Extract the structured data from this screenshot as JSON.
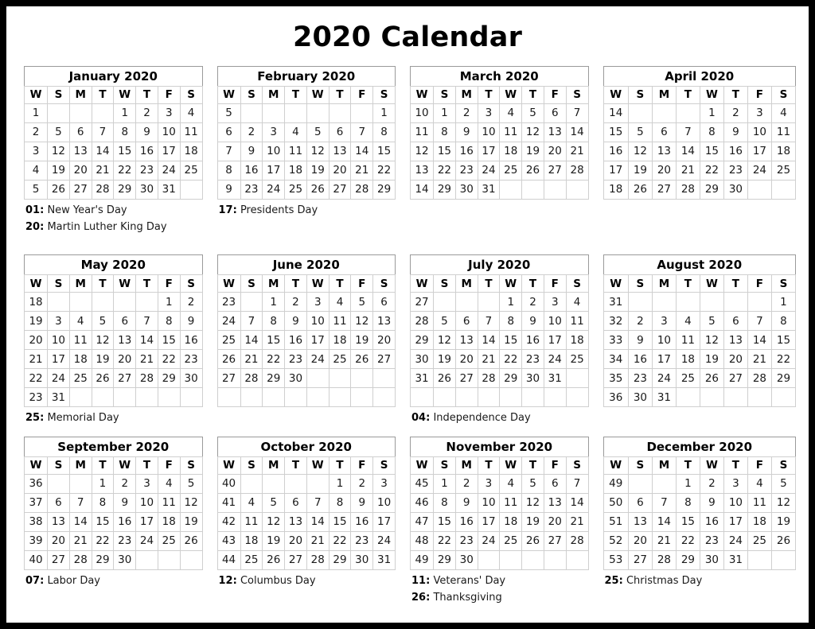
{
  "title": "2020 Calendar",
  "colors": {
    "week_number": "#3a9a3a",
    "holiday": "#e8202a",
    "text": "#1a1a1a",
    "border": "#cfcfcf",
    "page_border": "#000000"
  },
  "weekday_headers": [
    "W",
    "S",
    "M",
    "T",
    "W",
    "T",
    "F",
    "S"
  ],
  "months": [
    {
      "name": "January 2020",
      "weeks": [
        {
          "week": "1",
          "days": [
            "",
            "",
            "",
            "1",
            "2",
            "3",
            "4"
          ],
          "holidays": [
            1
          ]
        },
        {
          "week": "2",
          "days": [
            "5",
            "6",
            "7",
            "8",
            "9",
            "10",
            "11"
          ],
          "holidays": []
        },
        {
          "week": "3",
          "days": [
            "12",
            "13",
            "14",
            "15",
            "16",
            "17",
            "18"
          ],
          "holidays": []
        },
        {
          "week": "4",
          "days": [
            "19",
            "20",
            "21",
            "22",
            "23",
            "24",
            "25"
          ],
          "holidays": [
            20
          ]
        },
        {
          "week": "5",
          "days": [
            "26",
            "27",
            "28",
            "29",
            "30",
            "31",
            ""
          ],
          "holidays": []
        }
      ],
      "notes": [
        {
          "day": "01:",
          "label": "New Year's Day"
        },
        {
          "day": "20:",
          "label": "Martin Luther King Day"
        }
      ]
    },
    {
      "name": "February 2020",
      "weeks": [
        {
          "week": "5",
          "days": [
            "",
            "",
            "",
            "",
            "",
            "",
            "1"
          ],
          "holidays": []
        },
        {
          "week": "6",
          "days": [
            "2",
            "3",
            "4",
            "5",
            "6",
            "7",
            "8"
          ],
          "holidays": []
        },
        {
          "week": "7",
          "days": [
            "9",
            "10",
            "11",
            "12",
            "13",
            "14",
            "15"
          ],
          "holidays": []
        },
        {
          "week": "8",
          "days": [
            "16",
            "17",
            "18",
            "19",
            "20",
            "21",
            "22"
          ],
          "holidays": [
            17
          ]
        },
        {
          "week": "9",
          "days": [
            "23",
            "24",
            "25",
            "26",
            "27",
            "28",
            "29"
          ],
          "holidays": []
        }
      ],
      "notes": [
        {
          "day": "17:",
          "label": "Presidents Day"
        }
      ]
    },
    {
      "name": "March 2020",
      "weeks": [
        {
          "week": "10",
          "days": [
            "1",
            "2",
            "3",
            "4",
            "5",
            "6",
            "7"
          ],
          "holidays": []
        },
        {
          "week": "11",
          "days": [
            "8",
            "9",
            "10",
            "11",
            "12",
            "13",
            "14"
          ],
          "holidays": []
        },
        {
          "week": "12",
          "days": [
            "15",
            "16",
            "17",
            "18",
            "19",
            "20",
            "21"
          ],
          "holidays": []
        },
        {
          "week": "13",
          "days": [
            "22",
            "23",
            "24",
            "25",
            "26",
            "27",
            "28"
          ],
          "holidays": []
        },
        {
          "week": "14",
          "days": [
            "29",
            "30",
            "31",
            "",
            "",
            "",
            ""
          ],
          "holidays": []
        }
      ],
      "notes": []
    },
    {
      "name": "April 2020",
      "weeks": [
        {
          "week": "14",
          "days": [
            "",
            "",
            "",
            "1",
            "2",
            "3",
            "4"
          ],
          "holidays": []
        },
        {
          "week": "15",
          "days": [
            "5",
            "6",
            "7",
            "8",
            "9",
            "10",
            "11"
          ],
          "holidays": []
        },
        {
          "week": "16",
          "days": [
            "12",
            "13",
            "14",
            "15",
            "16",
            "17",
            "18"
          ],
          "holidays": []
        },
        {
          "week": "17",
          "days": [
            "19",
            "20",
            "21",
            "22",
            "23",
            "24",
            "25"
          ],
          "holidays": []
        },
        {
          "week": "18",
          "days": [
            "26",
            "27",
            "28",
            "29",
            "30",
            "",
            ""
          ],
          "holidays": []
        }
      ],
      "notes": []
    },
    {
      "name": "May 2020",
      "weeks": [
        {
          "week": "18",
          "days": [
            "",
            "",
            "",
            "",
            "",
            "1",
            "2"
          ],
          "holidays": []
        },
        {
          "week": "19",
          "days": [
            "3",
            "4",
            "5",
            "6",
            "7",
            "8",
            "9"
          ],
          "holidays": []
        },
        {
          "week": "20",
          "days": [
            "10",
            "11",
            "12",
            "13",
            "14",
            "15",
            "16"
          ],
          "holidays": []
        },
        {
          "week": "21",
          "days": [
            "17",
            "18",
            "19",
            "20",
            "21",
            "22",
            "23"
          ],
          "holidays": []
        },
        {
          "week": "22",
          "days": [
            "24",
            "25",
            "26",
            "27",
            "28",
            "29",
            "30"
          ],
          "holidays": [
            25
          ]
        },
        {
          "week": "23",
          "days": [
            "31",
            "",
            "",
            "",
            "",
            "",
            ""
          ],
          "holidays": []
        }
      ],
      "notes": [
        {
          "day": "25:",
          "label": "Memorial Day"
        }
      ]
    },
    {
      "name": "June 2020",
      "weeks": [
        {
          "week": "23",
          "days": [
            "",
            "1",
            "2",
            "3",
            "4",
            "5",
            "6"
          ],
          "holidays": []
        },
        {
          "week": "24",
          "days": [
            "7",
            "8",
            "9",
            "10",
            "11",
            "12",
            "13"
          ],
          "holidays": []
        },
        {
          "week": "25",
          "days": [
            "14",
            "15",
            "16",
            "17",
            "18",
            "19",
            "20"
          ],
          "holidays": []
        },
        {
          "week": "26",
          "days": [
            "21",
            "22",
            "23",
            "24",
            "25",
            "26",
            "27"
          ],
          "holidays": []
        },
        {
          "week": "27",
          "days": [
            "28",
            "29",
            "30",
            "",
            "",
            "",
            ""
          ],
          "holidays": []
        },
        {
          "week": "",
          "days": [
            "",
            "",
            "",
            "",
            "",
            "",
            ""
          ],
          "holidays": []
        }
      ],
      "notes": []
    },
    {
      "name": "July 2020",
      "weeks": [
        {
          "week": "27",
          "days": [
            "",
            "",
            "",
            "1",
            "2",
            "3",
            "4"
          ],
          "holidays": [
            4
          ]
        },
        {
          "week": "28",
          "days": [
            "5",
            "6",
            "7",
            "8",
            "9",
            "10",
            "11"
          ],
          "holidays": []
        },
        {
          "week": "29",
          "days": [
            "12",
            "13",
            "14",
            "15",
            "16",
            "17",
            "18"
          ],
          "holidays": []
        },
        {
          "week": "30",
          "days": [
            "19",
            "20",
            "21",
            "22",
            "23",
            "24",
            "25"
          ],
          "holidays": []
        },
        {
          "week": "31",
          "days": [
            "26",
            "27",
            "28",
            "29",
            "30",
            "31",
            ""
          ],
          "holidays": []
        },
        {
          "week": "",
          "days": [
            "",
            "",
            "",
            "",
            "",
            "",
            ""
          ],
          "holidays": []
        }
      ],
      "notes": [
        {
          "day": "04:",
          "label": "Independence Day"
        }
      ]
    },
    {
      "name": "August 2020",
      "weeks": [
        {
          "week": "31",
          "days": [
            "",
            "",
            "",
            "",
            "",
            "",
            "1"
          ],
          "holidays": []
        },
        {
          "week": "32",
          "days": [
            "2",
            "3",
            "4",
            "5",
            "6",
            "7",
            "8"
          ],
          "holidays": []
        },
        {
          "week": "33",
          "days": [
            "9",
            "10",
            "11",
            "12",
            "13",
            "14",
            "15"
          ],
          "holidays": []
        },
        {
          "week": "34",
          "days": [
            "16",
            "17",
            "18",
            "19",
            "20",
            "21",
            "22"
          ],
          "holidays": []
        },
        {
          "week": "35",
          "days": [
            "23",
            "24",
            "25",
            "26",
            "27",
            "28",
            "29"
          ],
          "holidays": []
        },
        {
          "week": "36",
          "days": [
            "30",
            "31",
            "",
            "",
            "",
            "",
            ""
          ],
          "holidays": []
        }
      ],
      "notes": []
    },
    {
      "name": "September 2020",
      "weeks": [
        {
          "week": "36",
          "days": [
            "",
            "",
            "1",
            "2",
            "3",
            "4",
            "5"
          ],
          "holidays": []
        },
        {
          "week": "37",
          "days": [
            "6",
            "7",
            "8",
            "9",
            "10",
            "11",
            "12"
          ],
          "holidays": [
            7
          ]
        },
        {
          "week": "38",
          "days": [
            "13",
            "14",
            "15",
            "16",
            "17",
            "18",
            "19"
          ],
          "holidays": []
        },
        {
          "week": "39",
          "days": [
            "20",
            "21",
            "22",
            "23",
            "24",
            "25",
            "26"
          ],
          "holidays": []
        },
        {
          "week": "40",
          "days": [
            "27",
            "28",
            "29",
            "30",
            "",
            "",
            ""
          ],
          "holidays": []
        }
      ],
      "notes": [
        {
          "day": "07:",
          "label": "Labor Day"
        }
      ]
    },
    {
      "name": "October 2020",
      "weeks": [
        {
          "week": "40",
          "days": [
            "",
            "",
            "",
            "",
            "1",
            "2",
            "3"
          ],
          "holidays": []
        },
        {
          "week": "41",
          "days": [
            "4",
            "5",
            "6",
            "7",
            "8",
            "9",
            "10"
          ],
          "holidays": []
        },
        {
          "week": "42",
          "days": [
            "11",
            "12",
            "13",
            "14",
            "15",
            "16",
            "17"
          ],
          "holidays": [
            12
          ]
        },
        {
          "week": "43",
          "days": [
            "18",
            "19",
            "20",
            "21",
            "22",
            "23",
            "24"
          ],
          "holidays": []
        },
        {
          "week": "44",
          "days": [
            "25",
            "26",
            "27",
            "28",
            "29",
            "30",
            "31"
          ],
          "holidays": []
        }
      ],
      "notes": [
        {
          "day": "12:",
          "label": "Columbus Day"
        }
      ]
    },
    {
      "name": "November 2020",
      "weeks": [
        {
          "week": "45",
          "days": [
            "1",
            "2",
            "3",
            "4",
            "5",
            "6",
            "7"
          ],
          "holidays": []
        },
        {
          "week": "46",
          "days": [
            "8",
            "9",
            "10",
            "11",
            "12",
            "13",
            "14"
          ],
          "holidays": [
            11
          ]
        },
        {
          "week": "47",
          "days": [
            "15",
            "16",
            "17",
            "18",
            "19",
            "20",
            "21"
          ],
          "holidays": []
        },
        {
          "week": "48",
          "days": [
            "22",
            "23",
            "24",
            "25",
            "26",
            "27",
            "28"
          ],
          "holidays": [
            26
          ]
        },
        {
          "week": "49",
          "days": [
            "29",
            "30",
            "",
            "",
            "",
            "",
            ""
          ],
          "holidays": []
        }
      ],
      "notes": [
        {
          "day": "11:",
          "label": "Veterans' Day"
        },
        {
          "day": "26:",
          "label": "Thanksgiving"
        }
      ]
    },
    {
      "name": "December 2020",
      "weeks": [
        {
          "week": "49",
          "days": [
            "",
            "",
            "1",
            "2",
            "3",
            "4",
            "5"
          ],
          "holidays": []
        },
        {
          "week": "50",
          "days": [
            "6",
            "7",
            "8",
            "9",
            "10",
            "11",
            "12"
          ],
          "holidays": []
        },
        {
          "week": "51",
          "days": [
            "13",
            "14",
            "15",
            "16",
            "17",
            "18",
            "19"
          ],
          "holidays": []
        },
        {
          "week": "52",
          "days": [
            "20",
            "21",
            "22",
            "23",
            "24",
            "25",
            "26"
          ],
          "holidays": [
            25
          ]
        },
        {
          "week": "53",
          "days": [
            "27",
            "28",
            "29",
            "30",
            "31",
            "",
            ""
          ],
          "holidays": []
        }
      ],
      "notes": [
        {
          "day": "25:",
          "label": "Christmas Day"
        }
      ]
    }
  ]
}
